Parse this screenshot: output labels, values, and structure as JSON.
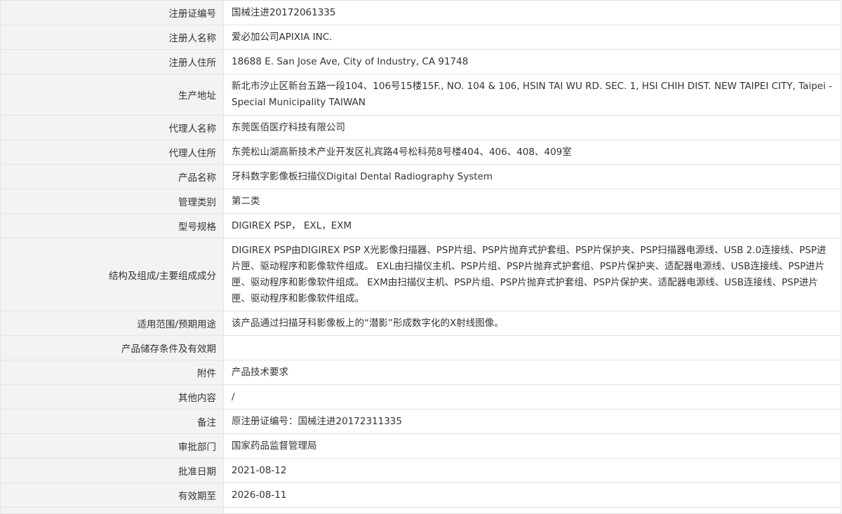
{
  "registration": {
    "rows": [
      {
        "label": "注册证编号",
        "value": "国械注进20172061335"
      },
      {
        "label": "注册人名称",
        "value": "爱必加公司APIXIA INC."
      },
      {
        "label": "注册人住所",
        "value": "18688 E. San Jose Ave, City of Industry, CA 91748"
      },
      {
        "label": "生产地址",
        "value": "新北市汐止区新台五路一段104、106号15楼15F., NO. 104 & 106, HSIN TAI WU RD. SEC. 1, HSI CHIH DIST. NEW TAIPEI CITY, Taipei - Special Municipality TAIWAN"
      },
      {
        "label": "代理人名称",
        "value": "东莞医佰医疗科技有限公司"
      },
      {
        "label": "代理人住所",
        "value": "东莞松山湖高新技术产业开发区礼宾路4号松科苑8号楼404、406、408、409室"
      },
      {
        "label": "产品名称",
        "value": "牙科数字影像板扫描仪Digital Dental Radiography System"
      },
      {
        "label": "管理类别",
        "value": "第二类"
      },
      {
        "label": "型号规格",
        "value": "DIGIREX PSP， EXL，EXM"
      },
      {
        "label": "结构及组成/主要组成成分",
        "value": "DIGIREX PSP由DIGIREX PSP X光影像扫描器、PSP片组、PSP片抛弃式护套组、PSP片保护夹、PSP扫描器电源线、USB 2.0连接线、PSP进片匣、驱动程序和影像软件组成。 EXL由扫描仪主机、PSP片组、PSP片抛弃式护套组、PSP片保护夹、适配器电源线、USB连接线、PSP进片匣、驱动程序和影像软件组成。 EXM由扫描仪主机、PSP片组、PSP片抛弃式护套组、PSP片保护夹、适配器电源线、USB连接线、PSP进片匣、驱动程序和影像软件组成。"
      },
      {
        "label": "适用范围/预期用途",
        "value": "该产品通过扫描牙科影像板上的“潜影”形成数字化的X射线图像。"
      },
      {
        "label": "产品储存条件及有效期",
        "value": ""
      },
      {
        "label": "附件",
        "value": "产品技术要求"
      },
      {
        "label": "其他内容",
        "value": "/"
      },
      {
        "label": "备注",
        "value": "原注册证编号：国械注进20172311335"
      },
      {
        "label": "审批部门",
        "value": "国家药品监督管理局"
      },
      {
        "label": "批准日期",
        "value": "2021-08-12"
      },
      {
        "label": "有效期至",
        "value": "2026-08-11"
      }
    ]
  }
}
